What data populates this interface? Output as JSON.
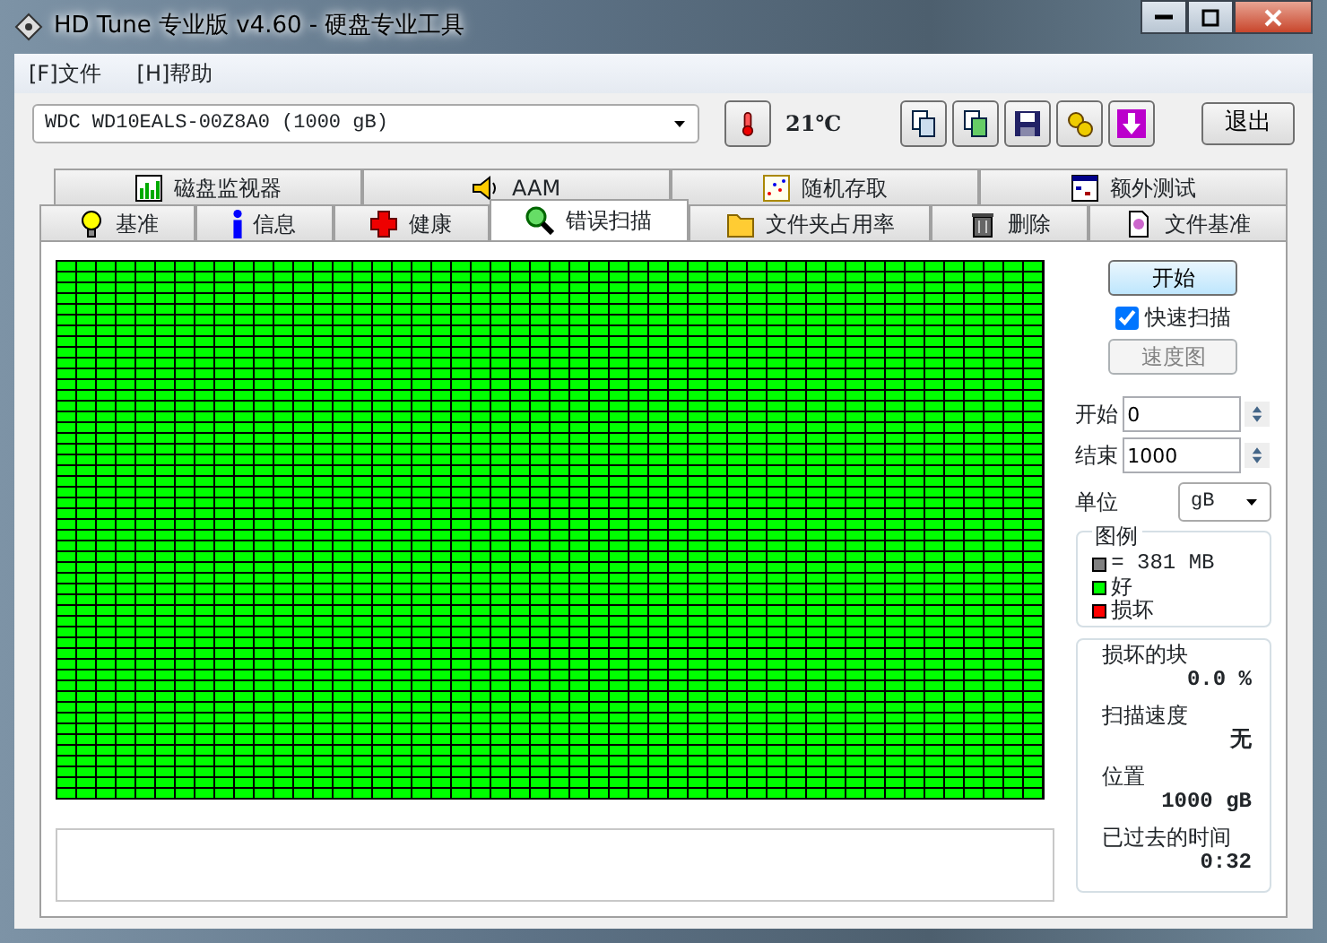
{
  "window": {
    "title": "HD Tune 专业版 v4.60 - 硬盘专业工具"
  },
  "menu": [
    {
      "label": "[F]文件"
    },
    {
      "label": "[H]帮助"
    }
  ],
  "toolbar": {
    "drive": "WDC WD10EALS-00Z8A0 (1000 gB)",
    "temperature": "21℃",
    "exit_button": "退出"
  },
  "tabs_top": [
    {
      "label": "磁盘监视器",
      "selected": false
    },
    {
      "label": "AAM",
      "selected": false
    },
    {
      "label": "随机存取",
      "selected": false
    },
    {
      "label": "额外测试",
      "selected": false
    }
  ],
  "tabs_bottom": [
    {
      "label": "基准",
      "selected": false
    },
    {
      "label": "信息",
      "selected": false
    },
    {
      "label": "健康",
      "selected": false
    },
    {
      "label": "错误扫描",
      "selected": true
    },
    {
      "label": "文件夹占用率",
      "selected": false
    },
    {
      "label": "删除",
      "selected": false
    },
    {
      "label": "文件基准",
      "selected": false
    }
  ],
  "controls": {
    "start_button": "开始",
    "quick_scan": {
      "label": "快速扫描",
      "checked": true
    },
    "speed_map_button": {
      "label": "速度图",
      "disabled": true
    },
    "start": {
      "label": "开始",
      "value": "0"
    },
    "end": {
      "label": "结束",
      "value": "1000"
    },
    "unit": {
      "label": "单位",
      "value": "gB"
    }
  },
  "legend": {
    "title": "图例",
    "items": [
      {
        "label": "= 381 MB",
        "color": "#808080"
      },
      {
        "label": "好",
        "color": "#00ff00"
      },
      {
        "label": "损坏",
        "color": "#ff0000"
      }
    ]
  },
  "stats": [
    {
      "label": "损坏的块",
      "value": "0.0 %"
    },
    {
      "label": "扫描速度",
      "value": "无"
    },
    {
      "label": "位置",
      "value": "1000 gB"
    },
    {
      "label": "已过去的时间",
      "value": "0:32"
    }
  ]
}
